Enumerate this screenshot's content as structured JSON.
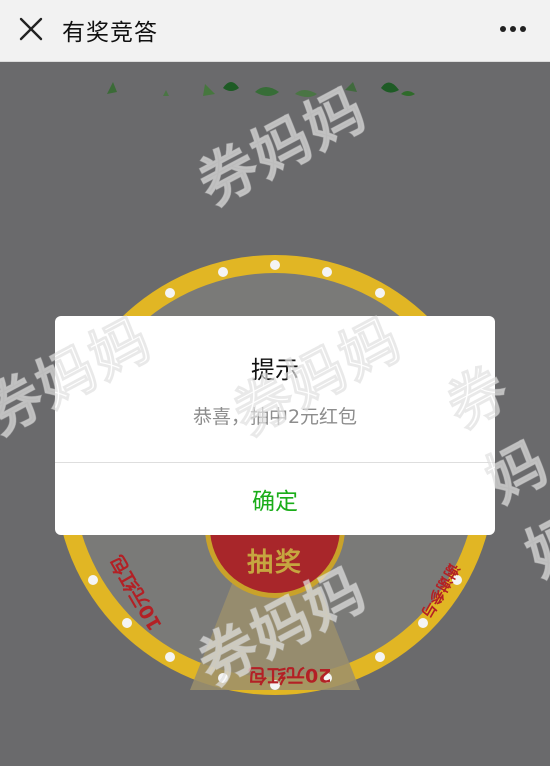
{
  "navbar": {
    "title": "有奖竞答",
    "close_icon": "close-icon",
    "more_icon": "more-dots-icon"
  },
  "wheel": {
    "draw_button_label": "抽奖",
    "prizes": [
      {
        "label": "10元红包"
      },
      {
        "label": "20元红包"
      },
      {
        "label": "谢谢参与"
      }
    ],
    "rim_color": "#e6b41a",
    "center_color": "#b32025"
  },
  "watermark_text": "券妈妈",
  "dialog": {
    "title": "提示",
    "message": "恭喜，抽中2元红包",
    "confirm_label": "确定",
    "confirm_color": "#1aad19"
  }
}
